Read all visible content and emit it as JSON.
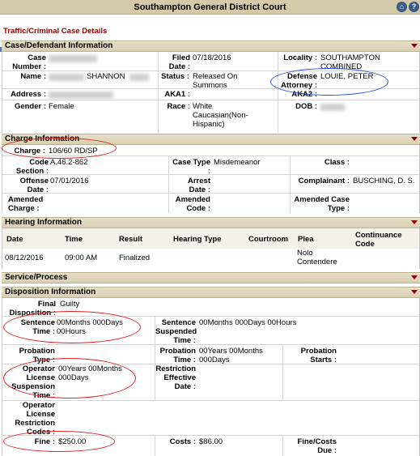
{
  "window": {
    "title": "Southampton General District Court"
  },
  "breadcrumb": "Traffic/Criminal Case Details",
  "sections": {
    "case_defendant": "Case/Defendant Information",
    "charge": "Charge Information",
    "hearing": "Hearing Information",
    "service": "Service/Process",
    "disposition": "Disposition Information"
  },
  "case": {
    "case_number_label": "Case Number :",
    "filed_label": "Filed Date :",
    "filed": "07/18/2016",
    "locality_label": "Locality :",
    "locality": "SOUTHAMPTON COMBINED",
    "name_label": "Name :",
    "name": "SHANNON",
    "status_label": "Status :",
    "status": "Released On Summons",
    "defense_label": "Defense Attorney :",
    "defense": "LOUIE, PETER",
    "address_label": "Address :",
    "aka1_label": "AKA1 :",
    "aka2_label": "AKA2 :",
    "gender_label": "Gender :",
    "gender": "Female",
    "race_label": "Race :",
    "race": "White Caucasian(Non-Hispanic)",
    "dob_label": "DOB :"
  },
  "charge": {
    "charge_label": "Charge :",
    "charge": "106/60 RD/SP",
    "code_section_label": "Code Section :",
    "code_section": "A.46.2-862",
    "case_type_label": "Case Type :",
    "case_type": "Misdemeanor",
    "class_label": "Class :",
    "offense_date_label": "Offense Date :",
    "offense_date": "07/01/2016",
    "arrest_date_label": "Arrest Date :",
    "complainant_label": "Complainant :",
    "complainant": "BUSCHING, D. S.",
    "amended_charge_label": "Amended Charge :",
    "amended_code_label": "Amended Code :",
    "amended_case_type_label": "Amended Case Type :"
  },
  "hearing": {
    "columns": [
      "Date",
      "Time",
      "Result",
      "Hearing Type",
      "Courtroom",
      "Plea",
      "Continuance Code"
    ],
    "rows": [
      {
        "date": "08/12/2016",
        "time": "09:00 AM",
        "result": "Finalized",
        "hearing_type": "",
        "courtroom": "",
        "plea": "Nolo Contendere",
        "continuance": ""
      }
    ]
  },
  "disposition": {
    "final_disposition_label": "Final Disposition :",
    "final_disposition": "Guilty",
    "sentence_time_label": "Sentence Time :",
    "sentence_time": "00Months 000Days 00Hours",
    "sentence_suspended_label": "Sentence Suspended Time :",
    "sentence_suspended": "00Months 000Days 00Hours",
    "probation_type_label": "Probation Type :",
    "probation_time_label": "Probation Time :",
    "probation_time": "00Years 00Months 000Days",
    "probation_starts_label": "Probation Starts :",
    "operator_suspension_label": "Operator License Suspension Time :",
    "operator_suspension": "00Years 00Months 000Days",
    "restriction_effective_label": "Restriction Effective Date :",
    "operator_restriction_label": "Operator License Restriction Codes :",
    "fine_label": "Fine :",
    "fine": "$250.00",
    "costs_label": "Costs :",
    "costs": "$86.00",
    "fine_costs_due_label": "Fine/Costs Due :"
  },
  "icons": {
    "home": "home-icon",
    "help": "help-icon",
    "collapse": "collapse-triangle-icon"
  },
  "colors": {
    "accent": "#8b0000",
    "header": "#d4c9a8",
    "annotation_red": "#dd2222",
    "annotation_blue": "#2a4fd0"
  }
}
